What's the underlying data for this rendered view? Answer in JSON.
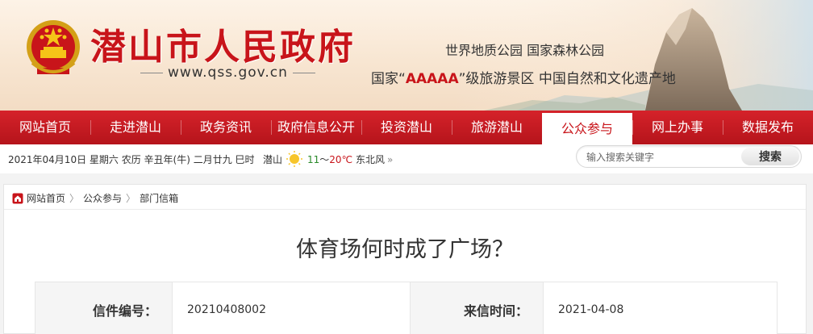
{
  "banner": {
    "title": "潜山市人民政府",
    "url": "www.qss.gov.cn",
    "slogan_line1": "世界地质公园 国家森林公园",
    "slogan_line2_prefix": "国家“",
    "slogan_line2_rating": "AAAAA",
    "slogan_line2_suffix": "”级旅游景区 中国自然和文化遗产地"
  },
  "nav": {
    "items": [
      {
        "label": "网站首页"
      },
      {
        "label": "走进潜山"
      },
      {
        "label": "政务资讯"
      },
      {
        "label": "政府信息公开"
      },
      {
        "label": "投资潜山"
      },
      {
        "label": "旅游潜山"
      },
      {
        "label": "公众参与",
        "active": true
      },
      {
        "label": "网上办事"
      },
      {
        "label": "数据发布"
      }
    ]
  },
  "infobar": {
    "date": "2021年04月10日 星期六 农历 辛丑年(牛) 二月廿九 巳时",
    "city": "潜山",
    "temp_low": "11",
    "temp_sep": "～",
    "temp_high": "20℃",
    "wind": "东北风",
    "weather_icon": "sunny-icon"
  },
  "search": {
    "placeholder": "输入搜索关键字",
    "button_label": "搜索"
  },
  "breadcrumb": {
    "items": [
      "网站首页",
      "公众参与",
      "部门信箱"
    ],
    "separator": "〉"
  },
  "letter": {
    "title": "体育场何时成了广场？",
    "number_label": "信件编号：",
    "number_value": "20210408002",
    "time_label": "来信时间：",
    "time_value": "2021-04-08"
  },
  "colors": {
    "brand_red": "#c8141a",
    "nav_red": "#c8161d"
  }
}
